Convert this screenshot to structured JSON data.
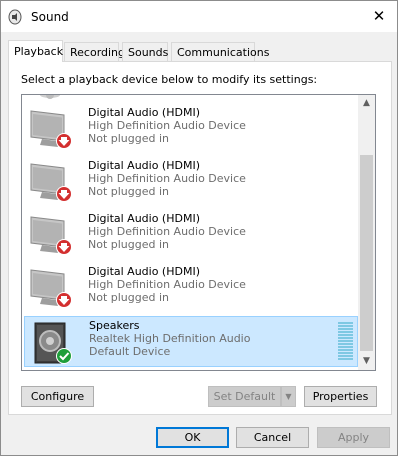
{
  "window": {
    "title": "Sound",
    "close_glyph": "✕"
  },
  "tabs": [
    {
      "label": "Playback",
      "active": true
    },
    {
      "label": "Recording",
      "active": false
    },
    {
      "label": "Sounds",
      "active": false
    },
    {
      "label": "Communications",
      "active": false
    }
  ],
  "instruction": "Select a playback device below to modify its settings:",
  "devices": [
    {
      "name": "Digital Audio (HDMI)",
      "description": "High Definition Audio Device",
      "status": "Not plugged in",
      "icon": "monitor-icon",
      "badge": "unplugged-arrow-icon"
    },
    {
      "name": "Digital Audio (HDMI)",
      "description": "High Definition Audio Device",
      "status": "Not plugged in",
      "icon": "monitor-icon",
      "badge": "unplugged-arrow-icon"
    },
    {
      "name": "Digital Audio (HDMI)",
      "description": "High Definition Audio Device",
      "status": "Not plugged in",
      "icon": "monitor-icon",
      "badge": "unplugged-arrow-icon"
    },
    {
      "name": "Digital Audio (HDMI)",
      "description": "High Definition Audio Device",
      "status": "Not plugged in",
      "icon": "monitor-icon",
      "badge": "unplugged-arrow-icon"
    },
    {
      "name": "Speakers",
      "description": "Realtek High Definition Audio",
      "status": "Default Device",
      "icon": "speaker-icon",
      "badge": "default-check-icon",
      "selected": true
    }
  ],
  "buttons": {
    "configure": "Configure",
    "set_default": "Set Default",
    "properties": "Properties",
    "ok": "OK",
    "cancel": "Cancel",
    "apply": "Apply"
  },
  "colors": {
    "accent": "#0078d7",
    "selection_bg": "#cce8ff",
    "unplugged_badge": "#d32f2f",
    "default_badge": "#1e9e3a"
  }
}
